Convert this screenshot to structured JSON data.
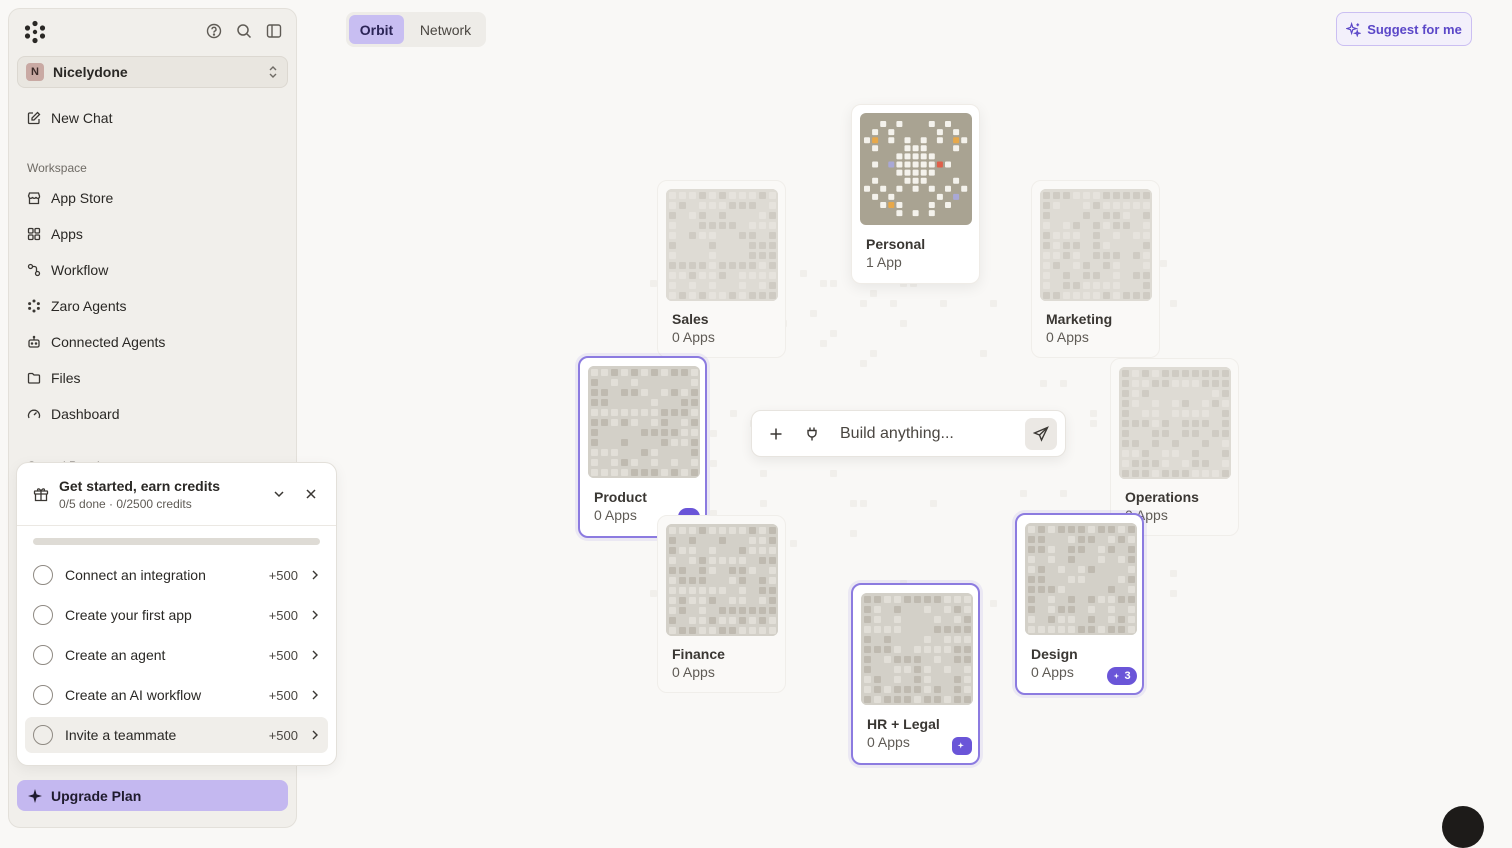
{
  "workspace": {
    "initial": "N",
    "name": "Nicelydone"
  },
  "nav": {
    "new_chat": "New Chat",
    "section_workspace": "Workspace",
    "items": [
      "App Store",
      "Apps",
      "Workflow",
      "Zaro Agents",
      "Connected Agents",
      "Files",
      "Dashboard"
    ],
    "section_control": "Control Panel"
  },
  "onboarding": {
    "title": "Get started, earn credits",
    "subtitle": "0/5 done · 0/2500 credits",
    "progress": 0,
    "tasks": [
      {
        "label": "Connect an integration",
        "points": "+500"
      },
      {
        "label": "Create your first app",
        "points": "+500"
      },
      {
        "label": "Create an agent",
        "points": "+500"
      },
      {
        "label": "Create an AI workflow",
        "points": "+500"
      },
      {
        "label": "Invite a teammate",
        "points": "+500"
      }
    ]
  },
  "upgrade_label": "Upgrade Plan",
  "view_toggle": {
    "orbit": "Orbit",
    "network": "Network",
    "active": "Orbit"
  },
  "suggest_label": "Suggest for me",
  "build": {
    "placeholder": "Build anything..."
  },
  "cards": {
    "personal": {
      "name": "Personal",
      "count": "1 App"
    },
    "sales": {
      "name": "Sales",
      "count": "0 Apps"
    },
    "marketing": {
      "name": "Marketing",
      "count": "0 Apps"
    },
    "product": {
      "name": "Product",
      "count": "0 Apps"
    },
    "operations": {
      "name": "Operations",
      "count": "0 Apps"
    },
    "finance": {
      "name": "Finance",
      "count": "0 Apps"
    },
    "hrlegal": {
      "name": "HR + Legal",
      "count": "0 Apps"
    },
    "design": {
      "name": "Design",
      "count": "0 Apps",
      "badge": "3"
    }
  },
  "colors": {
    "accent": "#6a55d8",
    "accent_soft": "#c8bef2",
    "background": "#f9f8f6"
  }
}
